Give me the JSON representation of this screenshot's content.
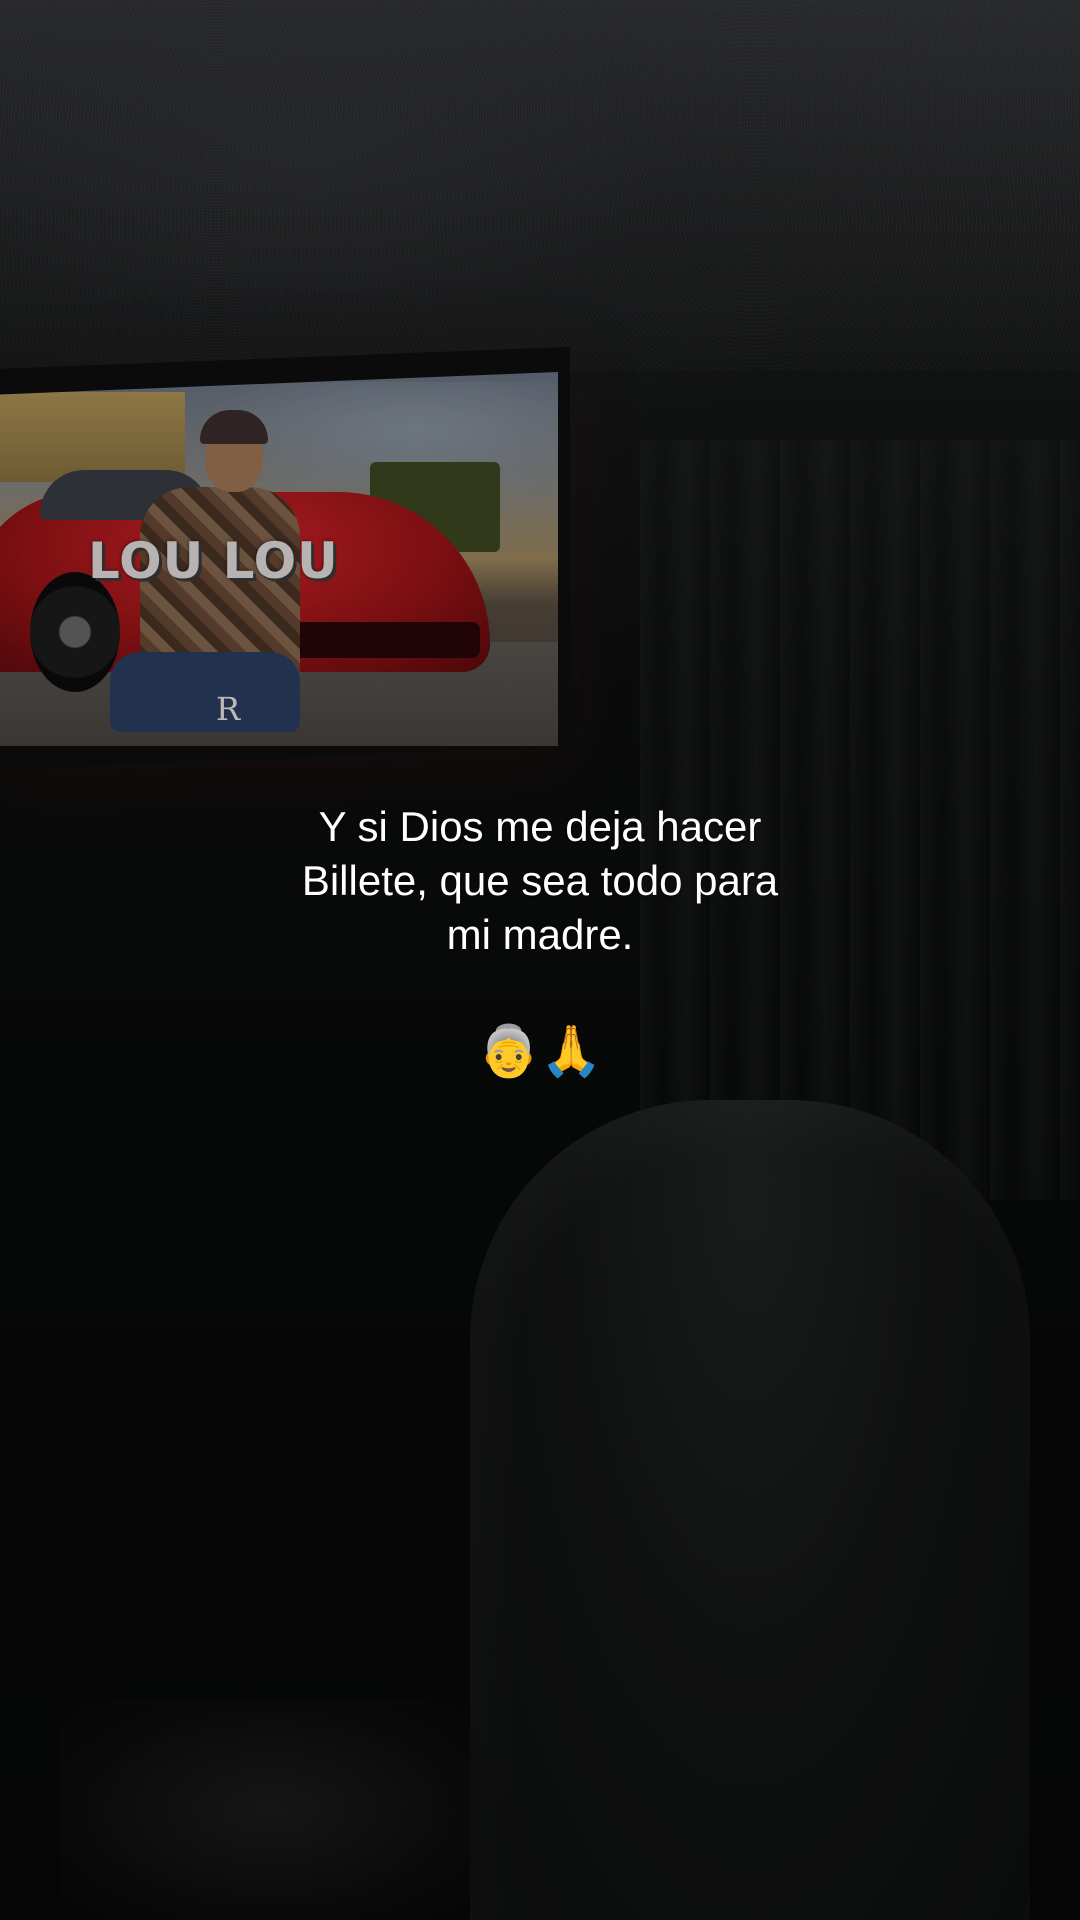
{
  "video_frame": {
    "tv_title": "LOU LOU",
    "tv_logo_letter": "R"
  },
  "caption": {
    "text": "Y si Dios me deja hacer\nBillete, que sea todo para\nmi madre."
  },
  "emoji": {
    "text": "👵🙏",
    "icons": [
      "old-woman-emoji",
      "praying-hands-emoji"
    ]
  }
}
